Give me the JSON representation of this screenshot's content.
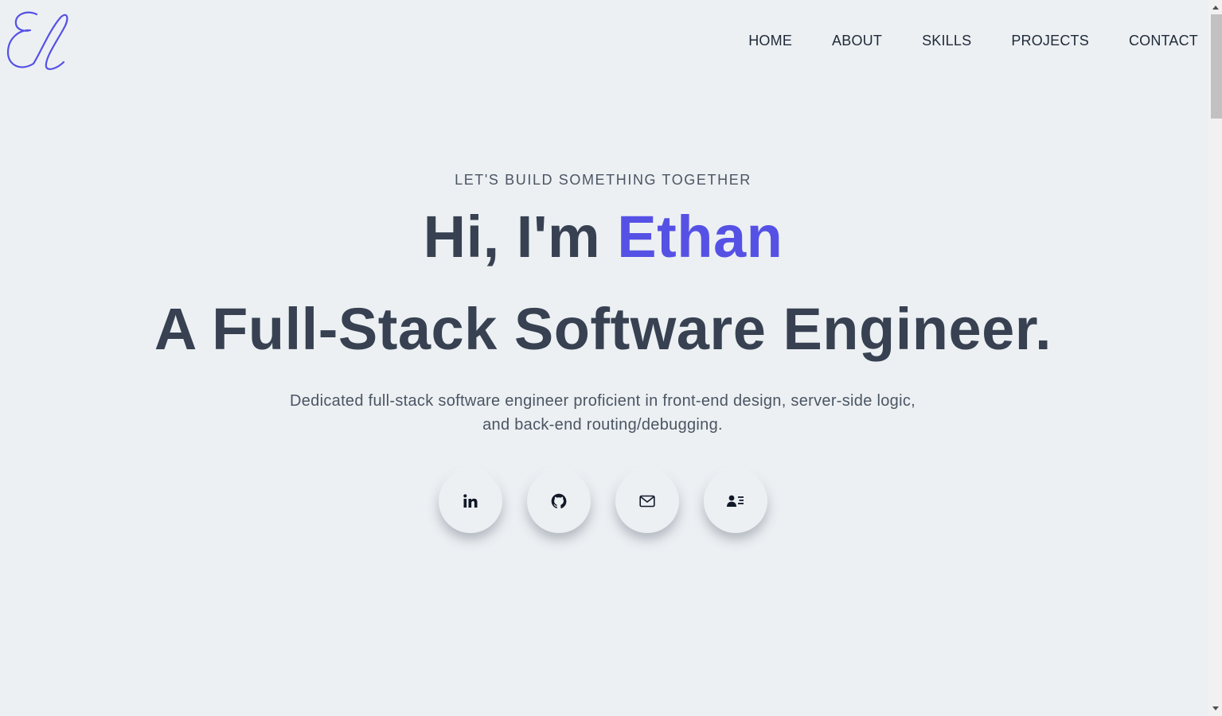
{
  "header": {
    "logo_text": "El",
    "nav": [
      {
        "label": "HOME"
      },
      {
        "label": "ABOUT"
      },
      {
        "label": "SKILLS"
      },
      {
        "label": "PROJECTS"
      },
      {
        "label": "CONTACT"
      }
    ]
  },
  "hero": {
    "eyebrow": "LET'S BUILD SOMETHING TOGETHER",
    "greeting": "Hi, I'm ",
    "name": "Ethan",
    "title": "A Full-Stack Software Engineer.",
    "description": "Dedicated full-stack software engineer proficient in front-end design, server-side logic, and back-end routing/debugging."
  },
  "socials": [
    {
      "icon": "linkedin-icon"
    },
    {
      "icon": "github-icon"
    },
    {
      "icon": "mail-icon"
    },
    {
      "icon": "resume-icon"
    }
  ],
  "colors": {
    "background": "#ecf0f3",
    "accent": "#5651e5",
    "text": "#374151"
  }
}
